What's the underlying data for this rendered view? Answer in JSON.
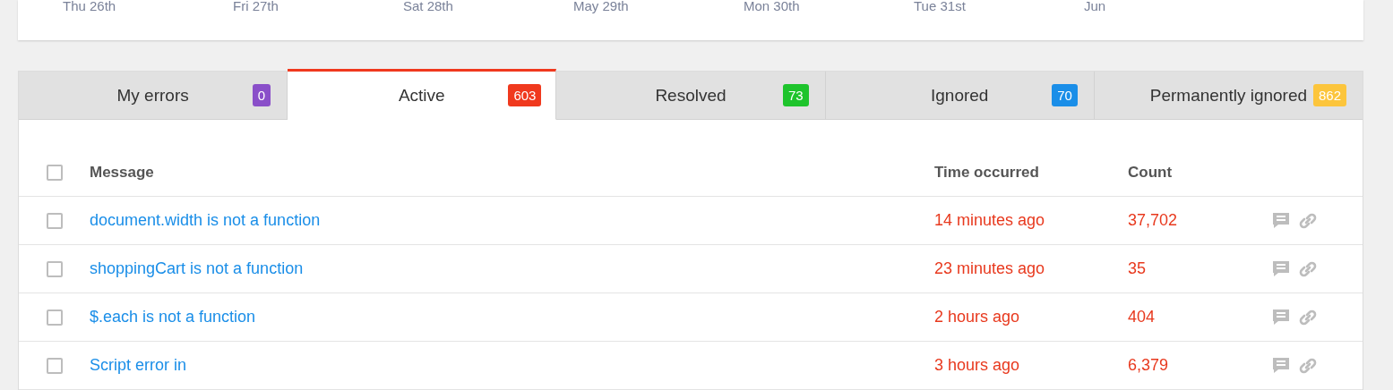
{
  "timeline": {
    "labels": [
      "Thu 26th",
      "Fri 27th",
      "Sat 28th",
      "May 29th",
      "Mon 30th",
      "Tue 31st",
      "Jun"
    ]
  },
  "tabs": [
    {
      "label": "My errors",
      "count": "0",
      "color": "#8a4fc9",
      "selected": false
    },
    {
      "label": "Active",
      "count": "603",
      "color": "#f0391e",
      "selected": true
    },
    {
      "label": "Resolved",
      "count": "73",
      "color": "#1ec42c",
      "selected": false
    },
    {
      "label": "Ignored",
      "count": "70",
      "color": "#1a8ee8",
      "selected": false
    },
    {
      "label": "Permanently ignored",
      "count": "862",
      "color": "#fcc53c",
      "selected": false
    }
  ],
  "table": {
    "select_all": {
      "checked": false
    },
    "columns": [
      "Message",
      "Time occurred",
      "Count"
    ],
    "rows": [
      {
        "checked": false,
        "message": "document.width is not a function",
        "time": "14 minutes ago",
        "count": "37,702"
      },
      {
        "checked": false,
        "message": "shoppingCart is not a function",
        "time": "23 minutes ago",
        "count": "35"
      },
      {
        "checked": false,
        "message": "$.each is not a function",
        "time": "2 hours ago",
        "count": "404"
      },
      {
        "checked": false,
        "message": "Script error in",
        "time": "3 hours ago",
        "count": "6,379"
      }
    ]
  }
}
